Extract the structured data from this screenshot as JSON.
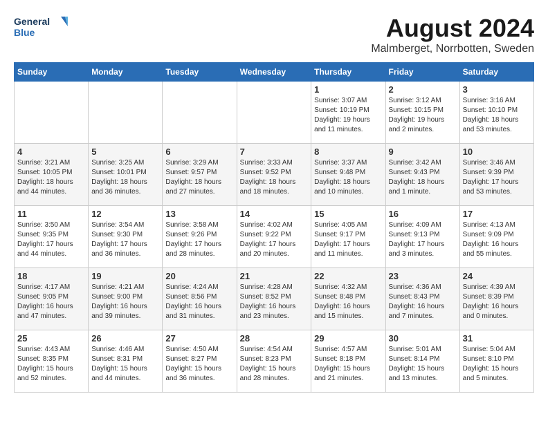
{
  "header": {
    "logo_line1": "General",
    "logo_line2": "Blue",
    "title": "August 2024",
    "subtitle": "Malmberget, Norrbotten, Sweden"
  },
  "calendar": {
    "headers": [
      "Sunday",
      "Monday",
      "Tuesday",
      "Wednesday",
      "Thursday",
      "Friday",
      "Saturday"
    ],
    "weeks": [
      [
        {
          "day": "",
          "info": ""
        },
        {
          "day": "",
          "info": ""
        },
        {
          "day": "",
          "info": ""
        },
        {
          "day": "",
          "info": ""
        },
        {
          "day": "1",
          "info": "Sunrise: 3:07 AM\nSunset: 10:19 PM\nDaylight: 19 hours\nand 11 minutes."
        },
        {
          "day": "2",
          "info": "Sunrise: 3:12 AM\nSunset: 10:15 PM\nDaylight: 19 hours\nand 2 minutes."
        },
        {
          "day": "3",
          "info": "Sunrise: 3:16 AM\nSunset: 10:10 PM\nDaylight: 18 hours\nand 53 minutes."
        }
      ],
      [
        {
          "day": "4",
          "info": "Sunrise: 3:21 AM\nSunset: 10:05 PM\nDaylight: 18 hours\nand 44 minutes."
        },
        {
          "day": "5",
          "info": "Sunrise: 3:25 AM\nSunset: 10:01 PM\nDaylight: 18 hours\nand 36 minutes."
        },
        {
          "day": "6",
          "info": "Sunrise: 3:29 AM\nSunset: 9:57 PM\nDaylight: 18 hours\nand 27 minutes."
        },
        {
          "day": "7",
          "info": "Sunrise: 3:33 AM\nSunset: 9:52 PM\nDaylight: 18 hours\nand 18 minutes."
        },
        {
          "day": "8",
          "info": "Sunrise: 3:37 AM\nSunset: 9:48 PM\nDaylight: 18 hours\nand 10 minutes."
        },
        {
          "day": "9",
          "info": "Sunrise: 3:42 AM\nSunset: 9:43 PM\nDaylight: 18 hours\nand 1 minute."
        },
        {
          "day": "10",
          "info": "Sunrise: 3:46 AM\nSunset: 9:39 PM\nDaylight: 17 hours\nand 53 minutes."
        }
      ],
      [
        {
          "day": "11",
          "info": "Sunrise: 3:50 AM\nSunset: 9:35 PM\nDaylight: 17 hours\nand 44 minutes."
        },
        {
          "day": "12",
          "info": "Sunrise: 3:54 AM\nSunset: 9:30 PM\nDaylight: 17 hours\nand 36 minutes."
        },
        {
          "day": "13",
          "info": "Sunrise: 3:58 AM\nSunset: 9:26 PM\nDaylight: 17 hours\nand 28 minutes."
        },
        {
          "day": "14",
          "info": "Sunrise: 4:02 AM\nSunset: 9:22 PM\nDaylight: 17 hours\nand 20 minutes."
        },
        {
          "day": "15",
          "info": "Sunrise: 4:05 AM\nSunset: 9:17 PM\nDaylight: 17 hours\nand 11 minutes."
        },
        {
          "day": "16",
          "info": "Sunrise: 4:09 AM\nSunset: 9:13 PM\nDaylight: 17 hours\nand 3 minutes."
        },
        {
          "day": "17",
          "info": "Sunrise: 4:13 AM\nSunset: 9:09 PM\nDaylight: 16 hours\nand 55 minutes."
        }
      ],
      [
        {
          "day": "18",
          "info": "Sunrise: 4:17 AM\nSunset: 9:05 PM\nDaylight: 16 hours\nand 47 minutes."
        },
        {
          "day": "19",
          "info": "Sunrise: 4:21 AM\nSunset: 9:00 PM\nDaylight: 16 hours\nand 39 minutes."
        },
        {
          "day": "20",
          "info": "Sunrise: 4:24 AM\nSunset: 8:56 PM\nDaylight: 16 hours\nand 31 minutes."
        },
        {
          "day": "21",
          "info": "Sunrise: 4:28 AM\nSunset: 8:52 PM\nDaylight: 16 hours\nand 23 minutes."
        },
        {
          "day": "22",
          "info": "Sunrise: 4:32 AM\nSunset: 8:48 PM\nDaylight: 16 hours\nand 15 minutes."
        },
        {
          "day": "23",
          "info": "Sunrise: 4:36 AM\nSunset: 8:43 PM\nDaylight: 16 hours\nand 7 minutes."
        },
        {
          "day": "24",
          "info": "Sunrise: 4:39 AM\nSunset: 8:39 PM\nDaylight: 16 hours\nand 0 minutes."
        }
      ],
      [
        {
          "day": "25",
          "info": "Sunrise: 4:43 AM\nSunset: 8:35 PM\nDaylight: 15 hours\nand 52 minutes."
        },
        {
          "day": "26",
          "info": "Sunrise: 4:46 AM\nSunset: 8:31 PM\nDaylight: 15 hours\nand 44 minutes."
        },
        {
          "day": "27",
          "info": "Sunrise: 4:50 AM\nSunset: 8:27 PM\nDaylight: 15 hours\nand 36 minutes."
        },
        {
          "day": "28",
          "info": "Sunrise: 4:54 AM\nSunset: 8:23 PM\nDaylight: 15 hours\nand 28 minutes."
        },
        {
          "day": "29",
          "info": "Sunrise: 4:57 AM\nSunset: 8:18 PM\nDaylight: 15 hours\nand 21 minutes."
        },
        {
          "day": "30",
          "info": "Sunrise: 5:01 AM\nSunset: 8:14 PM\nDaylight: 15 hours\nand 13 minutes."
        },
        {
          "day": "31",
          "info": "Sunrise: 5:04 AM\nSunset: 8:10 PM\nDaylight: 15 hours\nand 5 minutes."
        }
      ]
    ]
  }
}
